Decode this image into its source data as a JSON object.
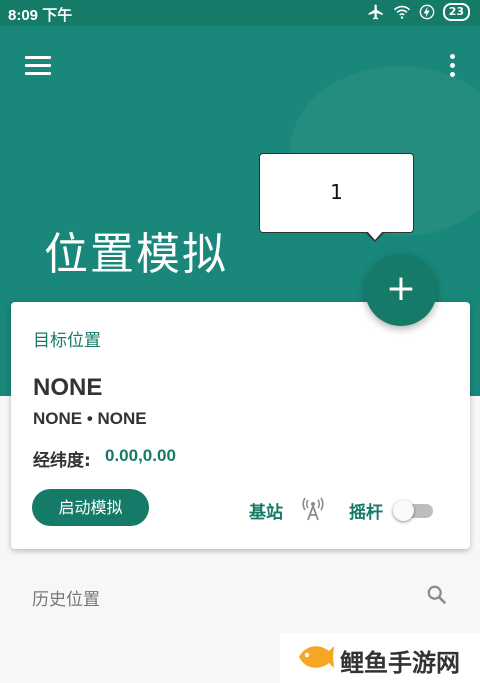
{
  "status_bar": {
    "time": "8:09 下午",
    "battery": "23"
  },
  "app": {
    "title": "位置模拟"
  },
  "tooltip": {
    "number": "1"
  },
  "fab": {
    "symbol": "+"
  },
  "card": {
    "section_label": "目标位置",
    "location_name": "NONE",
    "location_sub": "NONE • NONE",
    "coord_label": "经纬度:",
    "coord_value": "0.00,0.00",
    "start_button": "启动模拟",
    "base_station_label": "基站",
    "joystick_label": "摇杆",
    "joystick_enabled": false
  },
  "history": {
    "label": "历史位置"
  },
  "watermark": {
    "text": "鲤鱼手游网"
  },
  "colors": {
    "primary": "#19877a",
    "accent": "#157a68"
  }
}
